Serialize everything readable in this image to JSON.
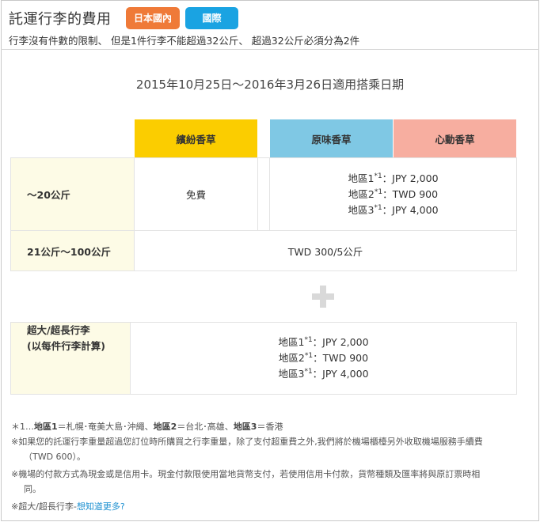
{
  "header": {
    "title": "託運行李的費用",
    "btn_domestic": "日本國內",
    "btn_international": "國際",
    "subtitle": "行李沒有件數的限制、 但是1件行李不能超過32公斤、 超過32公斤必須分為2件"
  },
  "period": "2015年10月25日～2016年3月26日適用搭乘日期",
  "table": {
    "col_yellow": "繽紛香草",
    "col_blue": "原味香草",
    "col_pink": "心動香草",
    "row1_label": "～20公斤",
    "row1_free": "免費",
    "row1_zone1_label": "地區1",
    "row1_zone1_value": "：JPY 2,000",
    "row1_zone2_label": "地區2",
    "row1_zone2_value": "：TWD 900",
    "row1_zone3_label": "地區3",
    "row1_zone3_value": "：JPY 4,000",
    "footnote_mark": "*1",
    "row2_label": "21公斤～100公斤",
    "row2_value": "TWD 300/5公斤"
  },
  "oversize": {
    "label_line1": "超大/超長行李",
    "label_line2": "(以每件行李計算)",
    "zone1_label": "地區1",
    "zone1_value": "：JPY 2,000",
    "zone2_label": "地區2",
    "zone2_value": "：TWD 900",
    "zone3_label": "地區3",
    "zone3_value": "：JPY 4,000",
    "footnote_mark": "*1"
  },
  "notes": {
    "n1_prefix": "＊1…",
    "n1_zone1": "地區1",
    "n1_zone1_val": "＝札幌･奄美大島･沖繩、",
    "n1_zone2": "地區2",
    "n1_zone2_val": "＝台北･高雄、",
    "n1_zone3": "地區3",
    "n1_zone3_val": "＝香港",
    "n2_line1": "※如果您的託運行李重量超過您訂位時所購買之行李重量，除了支付超重費之外,我們將於機場櫃檯另外收取機場服務手續費",
    "n2_line2": "（TWD 600）。",
    "n3_line1": "※機場的付款方式為現金或是信用卡。現金付款限使用當地貨幣支付，若使用信用卡付款，貨幣種類及匯率將與原訂票時相",
    "n3_line2": "同。",
    "n4_prefix": "※超大/超長行李-",
    "n4_link": "想知道更多?"
  },
  "colors": {
    "accent_orange": "#ef7a38",
    "accent_blue": "#1aa3e2",
    "col_yellow": "#fbcd00",
    "col_blue": "#7fc8e4",
    "col_pink": "#f7aea0",
    "row_label_bg": "#fdfbe6"
  },
  "icons": {
    "plus": "plus-icon"
  }
}
